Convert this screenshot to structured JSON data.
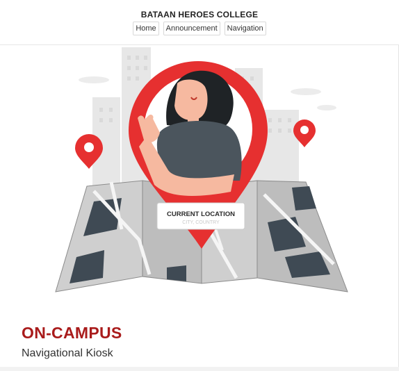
{
  "header": {
    "site_title": "BATAAN HEROES COLLEGE",
    "nav": [
      {
        "label": "Home"
      },
      {
        "label": "Announcement"
      },
      {
        "label": "Navigation"
      }
    ]
  },
  "hero": {
    "location_card_title": "CURRENT LOCATION",
    "location_card_sub": "CITY, COUNTRY"
  },
  "main": {
    "title": "ON-CAMPUS",
    "subtitle": "Navigational Kiosk"
  },
  "colors": {
    "brand_red": "#a91b1b",
    "pin_red": "#e63030",
    "map_dark": "#3f4a54",
    "shirt": "#4b555d"
  }
}
